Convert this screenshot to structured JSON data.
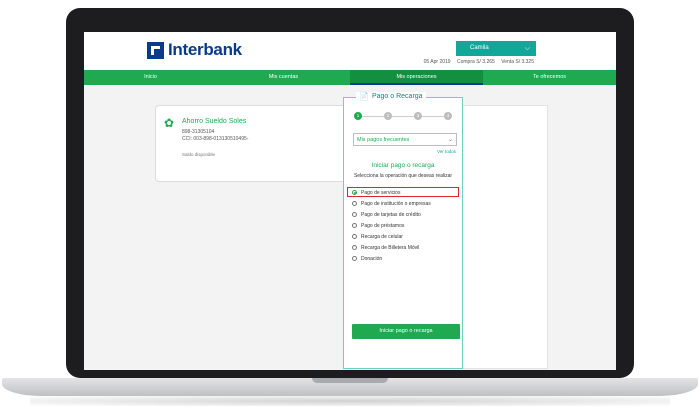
{
  "header": {
    "logo_text": "Interbank",
    "user_name": "Camila",
    "date": "05 Apr 2019",
    "buy": "Compra S/ 3.265",
    "sell": "Venta S/ 3.325"
  },
  "nav": {
    "items": [
      "Inicio",
      "Mis cuentas",
      "Mis operaciones",
      "Te ofrecemos"
    ],
    "active_index": 2
  },
  "account": {
    "name": "Ahorro Sueldo Soles",
    "number": "898-31305104",
    "cci": "CCI: 003-898-013130510495-",
    "saldo_label": "Saldo disponible"
  },
  "panel": {
    "title": "Pago o Recarga",
    "steps": [
      "1",
      "2",
      "3",
      "4"
    ],
    "current_step": 1,
    "select_value": "Mis pagos frecuentes",
    "ver_todos": "Ver todos",
    "section_title": "Iniciar pago o recarga",
    "section_subtitle": "Selecciona la operación que deseas realizar",
    "options": [
      "Pago de servicios",
      "Pago de institución o empresas",
      "Pago de tarjetas de crédito",
      "Pago de préstamos",
      "Recarga de celular",
      "Recarga de Billetera Móvil",
      "Donación"
    ],
    "selected_option": 0,
    "cta_label": "Iniciar pago o recarga"
  },
  "colors": {
    "brand_blue": "#0a3a8c",
    "green": "#1fa950",
    "teal": "#11a89a",
    "highlight_red": "#e0262d"
  }
}
